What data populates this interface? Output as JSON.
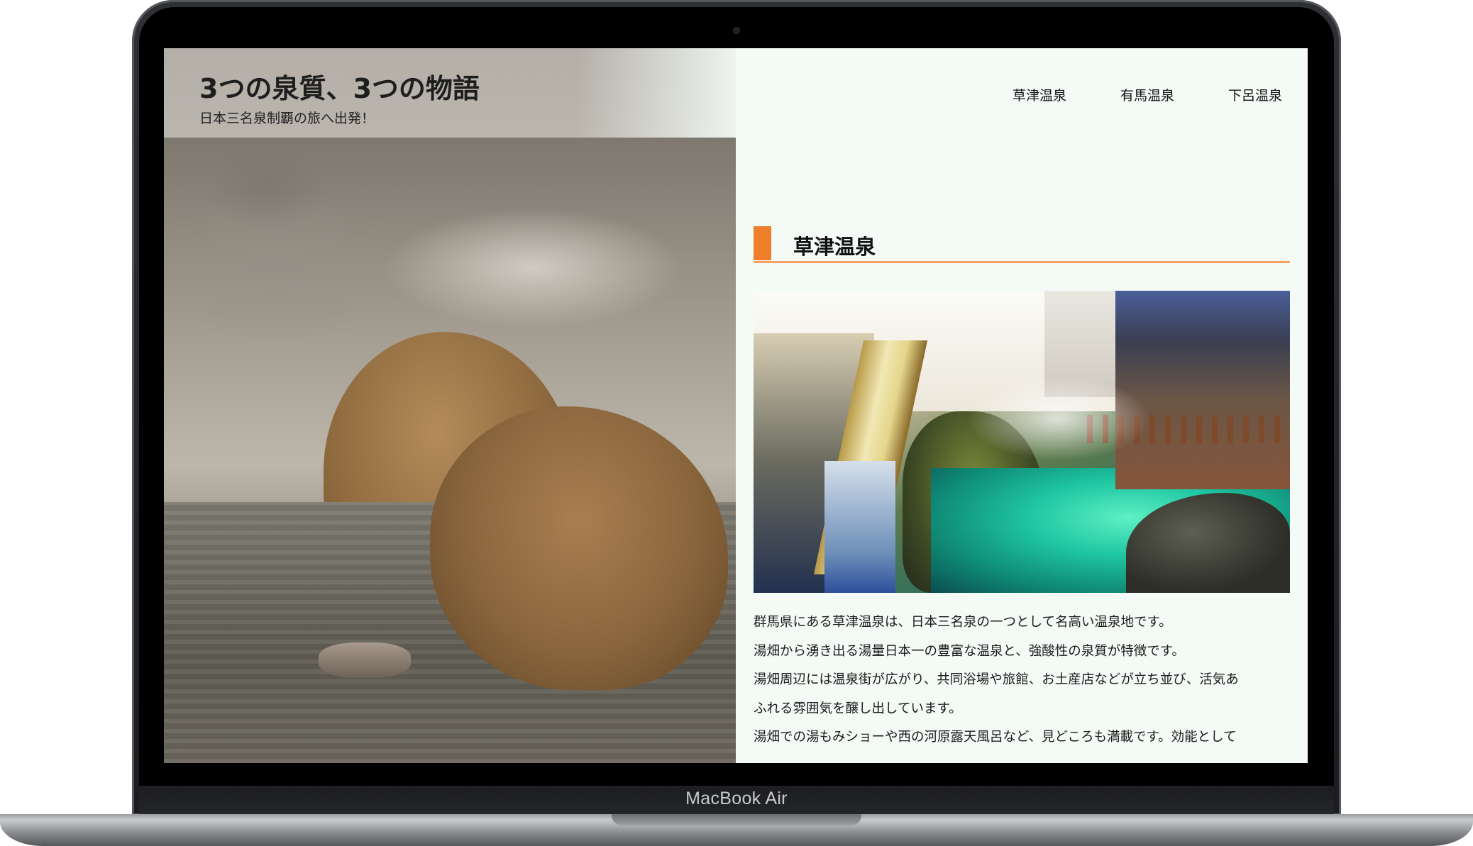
{
  "device": {
    "brand_label": "MacBook Air"
  },
  "site": {
    "title": "3つの泉質、3つの物語",
    "subtitle": "日本三名泉制覇の旅へ出発！"
  },
  "nav": {
    "items": [
      {
        "label": "草津温泉"
      },
      {
        "label": "有馬温泉"
      },
      {
        "label": "下呂温泉"
      }
    ]
  },
  "colors": {
    "accent": "#f07f2c",
    "underline": "#f6a163",
    "background": "#f4fbf6"
  },
  "section": {
    "title": "草津温泉",
    "description": [
      "群馬県にある草津温泉は、日本三名泉の一つとして名高い温泉地です。",
      "湯畑から湧き出る湯量日本一の豊富な温泉と、強酸性の泉質が特徴です。",
      "湯畑周辺には温泉街が広がり、共同浴場や旅館、お土産店などが立ち並び、活気あ",
      "ふれる雰囲気を醸し出しています。",
      "湯畑での湯もみショーや西の河原露天風呂など、見どころも満載です。効能として"
    ]
  }
}
